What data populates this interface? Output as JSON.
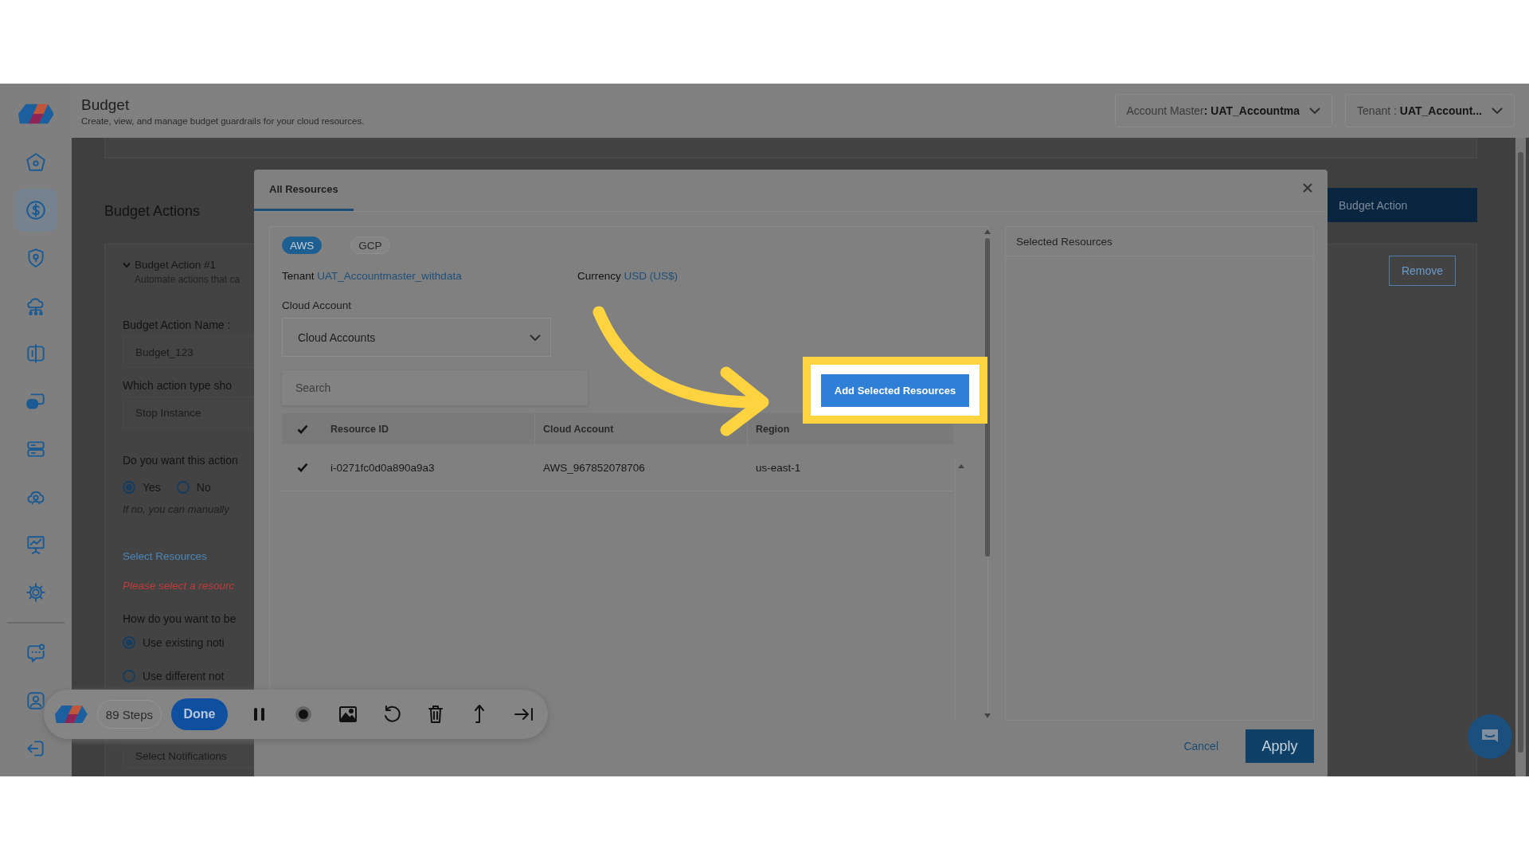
{
  "header": {
    "title": "Budget",
    "subtitle": "Create, view, and manage budget guardrails for your cloud resources.",
    "account_master": {
      "label": "Account Master",
      "value": ": UAT_Accountma"
    },
    "tenant": {
      "label": "Tenant :",
      "value": "UAT_Account..."
    }
  },
  "sidebar": {
    "items": [
      {
        "selected": false
      },
      {
        "selected": true
      },
      {
        "selected": false
      },
      {
        "selected": false
      },
      {
        "selected": false
      },
      {
        "selected": false
      },
      {
        "selected": false
      },
      {
        "selected": false
      },
      {
        "selected": false
      },
      {
        "selected": false
      }
    ],
    "bottom_items": [
      {
        "selected": false
      },
      {
        "selected": false
      },
      {
        "selected": false
      }
    ]
  },
  "page": {
    "section_title": "Budget Actions",
    "add_button": "Budget Action",
    "action": {
      "title": "Budget Action #1",
      "expanded": true,
      "description": "Automate actions that ca",
      "remove_button": "Remove"
    },
    "form": {
      "name_label": "Budget Action Name :",
      "name_value": "Budget_123",
      "type_label": "Which action type sho",
      "type_value": "Stop Instance",
      "confirm_label": "Do you want this action",
      "confirm_options": [
        {
          "label": "Yes",
          "selected": true
        },
        {
          "label": "No",
          "selected": false
        }
      ],
      "confirm_hint": "If no, you can manually",
      "resources_link": "Select Resources",
      "resources_error": "Please select a resourc",
      "notify_label": "How do you want to be",
      "notify_options": [
        {
          "label": "Use existing noti",
          "selected": true
        },
        {
          "label": "Use different not",
          "selected": false
        }
      ],
      "notifications_field": "Select Notifications"
    }
  },
  "modal": {
    "tabs": [
      {
        "label": "All Resources",
        "selected": true
      }
    ],
    "providers": [
      {
        "label": "AWS",
        "selected": true
      },
      {
        "label": "GCP",
        "selected": false
      }
    ],
    "tenant_label": "Tenant",
    "tenant_value": "UAT_Accountmaster_withdata",
    "currency_label": "Currency",
    "currency_value": "USD (US$)",
    "cloud_account_label": "Cloud Account",
    "cloud_account_select": "Cloud Accounts",
    "search_placeholder": "Search",
    "table": {
      "all_checked": true,
      "columns": [
        "Resource ID",
        "Cloud Account",
        "Region"
      ],
      "rows": [
        {
          "checked": true,
          "cells": [
            "i-0271fc0d0a890a9a3",
            "AWS_967852078706",
            "us-east-1"
          ]
        }
      ]
    },
    "add_button": "Add Selected Resources",
    "selected_title": "Selected Resources",
    "cancel": "Cancel",
    "apply": "Apply"
  },
  "recorder": {
    "steps": "89 Steps",
    "done": "Done"
  }
}
